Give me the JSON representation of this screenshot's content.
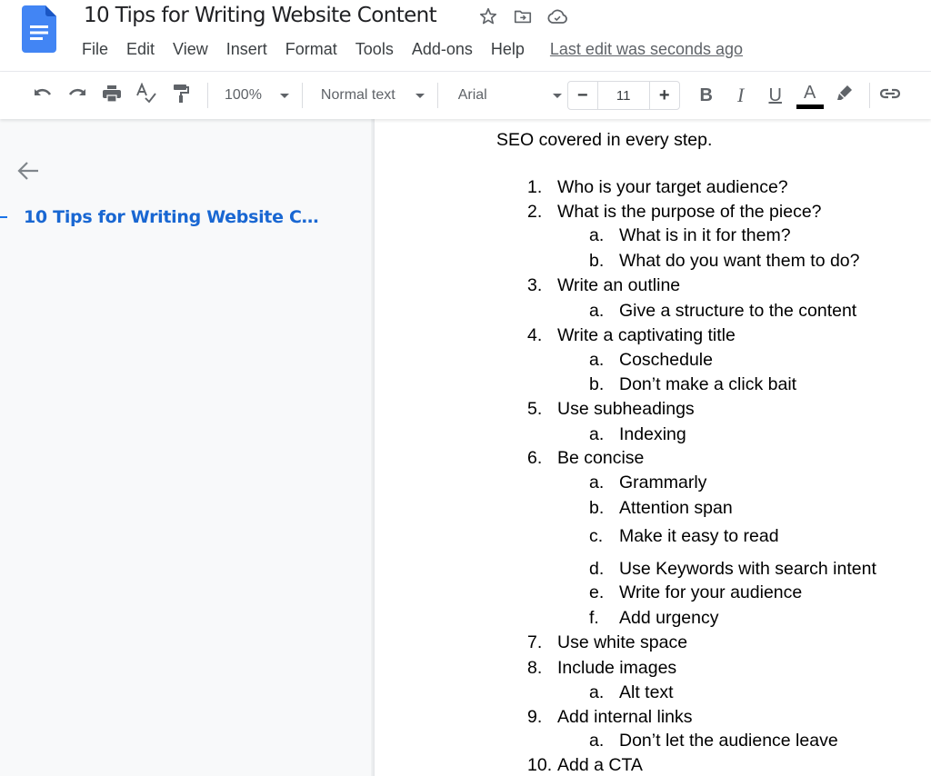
{
  "app": {
    "doc_title": "10 Tips for Writing Website Content",
    "icons": [
      "docs-logo-icon",
      "star-icon",
      "move-to-folder-icon",
      "cloud-saved-icon"
    ]
  },
  "menubar": {
    "items": [
      "File",
      "Edit",
      "View",
      "Insert",
      "Format",
      "Tools",
      "Add-ons",
      "Help"
    ],
    "last_edit": "Last edit was seconds ago"
  },
  "toolbar": {
    "zoom": "100%",
    "style": "Normal text",
    "font": "Arial",
    "font_size": "11",
    "decrease_label": "−",
    "increase_label": "+",
    "bold_label": "B",
    "italic_label": "I",
    "underline_label": "U",
    "text_color_label": "A",
    "text_color": "#000000",
    "icons": [
      "undo-icon",
      "redo-icon",
      "print-icon",
      "spellcheck-icon",
      "paint-format-icon",
      "highlight-icon",
      "link-icon"
    ]
  },
  "outline": {
    "items": [
      {
        "label": "10 Tips for Writing Website C…",
        "active": true
      }
    ]
  },
  "document": {
    "intro": "SEO covered in every step.",
    "list": [
      {
        "num": "1.",
        "text": "Who is your target audience?",
        "sub": []
      },
      {
        "num": "2.",
        "text": "What is the purpose of the piece?",
        "sub": [
          {
            "num": "a.",
            "text": "What is in it for them?"
          },
          {
            "num": "b.",
            "text": "What do you want them to do?"
          }
        ]
      },
      {
        "num": "3.",
        "text": "Write an outline",
        "sub": [
          {
            "num": "a.",
            "text": "Give a structure to the content"
          }
        ]
      },
      {
        "num": "4.",
        "text": "Write a captivating title",
        "sub": [
          {
            "num": "a.",
            "text": "Coschedule"
          },
          {
            "num": "b.",
            "text": "Don’t make a click bait"
          }
        ]
      },
      {
        "num": "5.",
        "text": "Use subheadings",
        "sub": [
          {
            "num": "a.",
            "text": "Indexing"
          }
        ]
      },
      {
        "num": "6.",
        "text": "Be concise",
        "sub": [
          {
            "num": "a.",
            "text": "Grammarly"
          },
          {
            "num": "b.",
            "text": "Attention span"
          },
          {
            "num": "c.",
            "text": "Make it easy to read"
          },
          {
            "num": "d.",
            "text": "Use Keywords with search intent"
          },
          {
            "num": "e.",
            "text": "Write for your audience"
          },
          {
            "num": "f.",
            "text": "Add urgency"
          }
        ]
      },
      {
        "num": "7.",
        "text": "Use white space",
        "sub": []
      },
      {
        "num": "8.",
        "text": "Include images",
        "sub": [
          {
            "num": "a.",
            "text": "Alt text"
          }
        ]
      },
      {
        "num": "9.",
        "text": "Add internal links",
        "sub": [
          {
            "num": "a.",
            "text": "Don’t let the audience leave"
          }
        ]
      },
      {
        "num": "10.",
        "text": "Add a CTA",
        "sub": []
      }
    ]
  }
}
